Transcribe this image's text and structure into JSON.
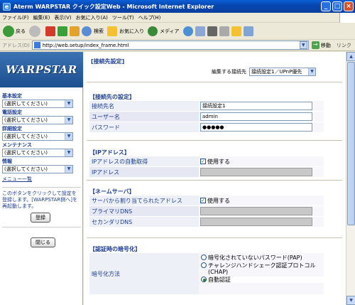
{
  "window": {
    "title": "Aterm WARPSTAR クイック設定Web - Microsoft Internet Explorer"
  },
  "menubar": [
    "ファイル(F)",
    "編集(E)",
    "表示(V)",
    "お気に入り(A)",
    "ツール(T)",
    "ヘルプ(H)"
  ],
  "toolbar": {
    "back": "戻る",
    "search": "検索",
    "favorites": "お気に入り",
    "media": "メディア"
  },
  "addressbar": {
    "label": "アドレス(D)",
    "url": "http://web.setup/index_frame.html",
    "go": "移動",
    "links": "リンク"
  },
  "left": {
    "logo": "WARPSTAR",
    "nav": [
      {
        "label": "基本設定",
        "value": "(選択してください)"
      },
      {
        "label": "電話設定",
        "value": "(選択してください)"
      },
      {
        "label": "詳細設定",
        "value": "(選択してください)"
      },
      {
        "label": "メンテナンス",
        "value": "(選択してください)"
      },
      {
        "label": "情報",
        "value": "(選択してください)"
      }
    ],
    "menu_list": "メニュー一覧",
    "note": "このボタンをクリックして設定を登録します。[WARPSTAR側へ]を再起動します。",
    "register": "登録",
    "close": "閉じる"
  },
  "main": {
    "header": "[接続先設定]",
    "edit_label": "編集する接続先",
    "edit_value": "接続設定1／UPnP優先",
    "sections": {
      "conn": {
        "title": "【接続先の設定】",
        "name_label": "接続先名",
        "name_value": "接続設定1",
        "user_label": "ユーザー名",
        "user_value": "admin",
        "pass_label": "パスワード",
        "pass_value": "●●●●●"
      },
      "ip": {
        "title": "【IPアドレス】",
        "auto_label": "IPアドレスの自動取得",
        "auto_value": "使用する",
        "addr_label": "IPアドレス"
      },
      "dns": {
        "title": "【ネームサーバ】",
        "auto_label": "サーバから割り当てられたアドレス",
        "auto_value": "使用する",
        "primary_label": "プライマリDNS",
        "secondary_label": "セカンダリDNS"
      },
      "auth": {
        "title": "【認証時の暗号化】",
        "method_label": "暗号化方法",
        "opt1": "暗号化されていないパスワード(PAP)",
        "opt2": "チャレンジハンドシェーク認証プロトコル(CHAP)",
        "opt3": "自動認証"
      }
    }
  }
}
